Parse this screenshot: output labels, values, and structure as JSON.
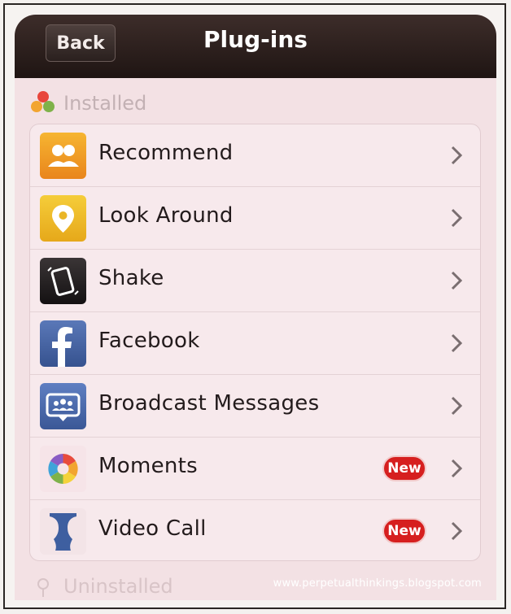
{
  "header": {
    "back_label": "Back",
    "title": "Plug-ins"
  },
  "sections": {
    "installed": "Installed",
    "uninstalled": "Uninstalled"
  },
  "items": [
    {
      "label": "Recommend",
      "icon": "recommend-icon",
      "badge": ""
    },
    {
      "label": "Look Around",
      "icon": "location-pin-icon",
      "badge": ""
    },
    {
      "label": "Shake",
      "icon": "shake-phone-icon",
      "badge": ""
    },
    {
      "label": "Facebook",
      "icon": "facebook-icon",
      "badge": ""
    },
    {
      "label": "Broadcast Messages",
      "icon": "broadcast-messages-icon",
      "badge": ""
    },
    {
      "label": "Moments",
      "icon": "moments-icon",
      "badge": "New"
    },
    {
      "label": "Video Call",
      "icon": "video-call-icon",
      "badge": "New"
    }
  ],
  "watermark": "www.perpetualthinkings.blogspot.com",
  "colors": {
    "topbar": "#2b1d1b",
    "background": "#f3e1e4",
    "badge": "#d61f1f",
    "text": "#231b1c"
  }
}
